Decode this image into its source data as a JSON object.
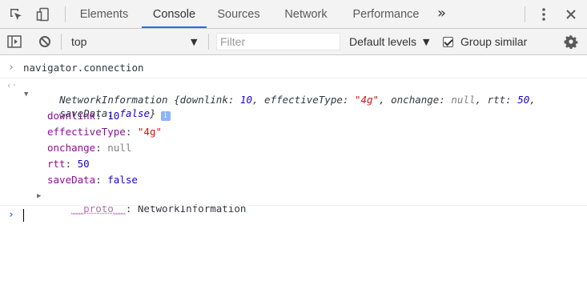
{
  "tabbar": {
    "tabs": [
      "Elements",
      "Console",
      "Sources",
      "Network",
      "Performance"
    ],
    "active_tab": "Console",
    "more": "»",
    "menu_icon": "vertical-dots-icon",
    "close_icon": "close-icon"
  },
  "toolbar": {
    "context": "top",
    "filter_placeholder": "Filter",
    "levels": "Default levels",
    "group_similar": "Group similar",
    "group_similar_checked": true
  },
  "console": {
    "input_command": "navigator.connection",
    "summary_type": "NetworkInformation",
    "summary_line1_parts": [
      {
        "t": " {",
        "c": "plain"
      },
      {
        "t": "downlink",
        "c": "plain"
      },
      {
        "t": ": ",
        "c": "plain"
      },
      {
        "t": "10",
        "c": "val-blue"
      },
      {
        "t": ", ",
        "c": "plain"
      },
      {
        "t": "effectiveType",
        "c": "plain"
      },
      {
        "t": ": ",
        "c": "plain"
      },
      {
        "t": "\"4g\"",
        "c": "val-str"
      },
      {
        "t": ", ",
        "c": "plain"
      },
      {
        "t": "onchange",
        "c": "plain"
      },
      {
        "t": ": ",
        "c": "plain"
      },
      {
        "t": "null",
        "c": "val-null"
      },
      {
        "t": ", ",
        "c": "plain"
      },
      {
        "t": "rtt",
        "c": "plain"
      },
      {
        "t": ": ",
        "c": "plain"
      },
      {
        "t": "50",
        "c": "val-blue"
      },
      {
        "t": ",",
        "c": "plain"
      }
    ],
    "summary_line2_parts": [
      {
        "t": "saveData",
        "c": "plain"
      },
      {
        "t": ": ",
        "c": "plain"
      },
      {
        "t": "false",
        "c": "val-blue"
      },
      {
        "t": "}",
        "c": "plain"
      }
    ],
    "properties": [
      {
        "key": "downlink",
        "value": "10",
        "kind": "number"
      },
      {
        "key": "effectiveType",
        "value": "\"4g\"",
        "kind": "string"
      },
      {
        "key": "onchange",
        "value": "null",
        "kind": "null"
      },
      {
        "key": "rtt",
        "value": "50",
        "kind": "number"
      },
      {
        "key": "saveData",
        "value": "false",
        "kind": "boolean"
      }
    ],
    "proto_key": "__proto__",
    "proto_value": "NetworkInformation",
    "info_badge": "i"
  },
  "colors": {
    "accent": "#1a73e8",
    "prompt": "#1a73e8",
    "property_key": "#881391",
    "number": "#1c00cf",
    "string": "#c41a16",
    "null": "#808080"
  }
}
